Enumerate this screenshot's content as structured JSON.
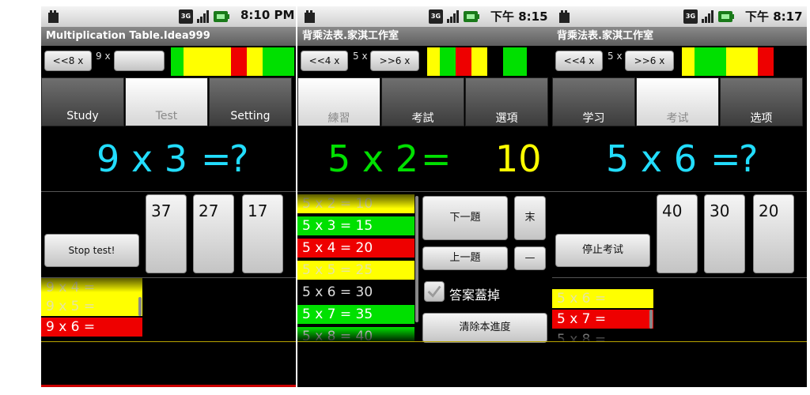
{
  "colors": {
    "yellow": "#ffff00",
    "green": "#00e000",
    "red": "#ee0000",
    "cyan": "#22ddff",
    "black": "#000000"
  },
  "screens": [
    {
      "status_time": "8:10 PM",
      "title": "Multiplication Table.Idea999",
      "nav": {
        "prev": "<<8 x",
        "current": "9 x",
        "next": ""
      },
      "progress_bar": [
        "green",
        "yellow",
        "yellow",
        "red",
        "yellow",
        "green",
        "green"
      ],
      "tabs": [
        "Study",
        "Test",
        "Setting"
      ],
      "active_tab": 1,
      "question": {
        "left": "9 x  3",
        "equals": "=",
        "right": "?"
      },
      "answers": [
        "37",
        "27",
        "17"
      ],
      "stop_button": "Stop test!",
      "history": [
        {
          "text": "9 x 4 =",
          "color": "yellow"
        },
        {
          "text": "9 x 5 =",
          "color": "yellow"
        },
        {
          "text": "9 x 6 =",
          "color": "red"
        }
      ]
    },
    {
      "status_time": "下午 8:15",
      "title": "背乘法表.家淇工作室",
      "nav": {
        "prev": "<<4 x",
        "current": "5 x",
        "next": ">>6 x"
      },
      "progress_bar": [
        "yellow",
        "green",
        "red",
        "yellow",
        "black",
        "green",
        "green"
      ],
      "tabs": [
        "練習",
        "考試",
        "選項"
      ],
      "active_tab": 0,
      "question": {
        "left": "5 x 2",
        "equals": "=",
        "right": "10"
      },
      "history": [
        {
          "text": "5 x  2 = 10",
          "color": "yellow"
        },
        {
          "text": "5 x  3 = 15",
          "color": "green"
        },
        {
          "text": "5 x  4 = 20",
          "color": "red"
        },
        {
          "text": "5 x  5 = 25",
          "color": "yellow"
        },
        {
          "text": "5 x  6 = 30",
          "color": "black"
        },
        {
          "text": "5 x  7 = 35",
          "color": "green"
        },
        {
          "text": "5 x  8 = 40",
          "color": "green"
        }
      ],
      "buttons": {
        "next_question": "下一題",
        "last": "末",
        "prev_question": "上一題",
        "minus": "—",
        "clear_progress": "清除本進度"
      },
      "checkbox_label": "答案蓋掉"
    },
    {
      "status_time": "下午 8:17",
      "title": "背乘法表.家淇工作室",
      "nav": {
        "prev": "<<4 x",
        "current": "5 x",
        "next": ">>6 x"
      },
      "progress_bar": [
        "yellow",
        "green",
        "green",
        "yellow",
        "yellow",
        "red",
        "black"
      ],
      "tabs": [
        "学习",
        "考试",
        "选项"
      ],
      "active_tab": 1,
      "question": {
        "left": "5 x  6",
        "equals": "=",
        "right": "?"
      },
      "answers": [
        "40",
        "30",
        "20"
      ],
      "stop_button": "停止考试",
      "history": [
        {
          "text": "5 x  6 =",
          "color": "yellow"
        },
        {
          "text": "5 x  7 =",
          "color": "red"
        },
        {
          "text": "5 x  8 =",
          "color": "black"
        }
      ]
    }
  ]
}
